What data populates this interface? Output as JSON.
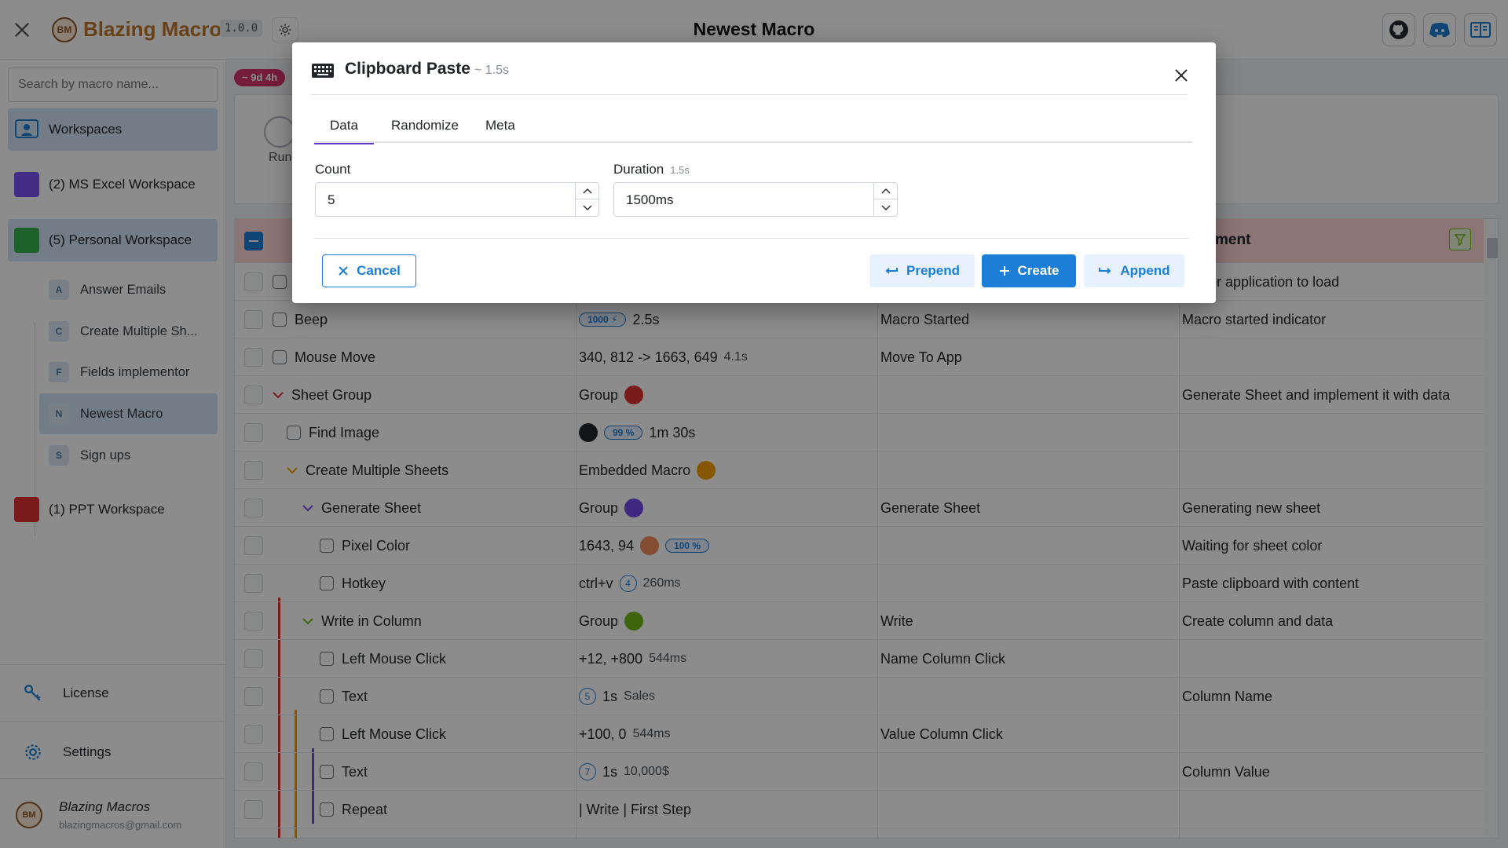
{
  "app": {
    "brand": "Blazing Macros",
    "logo_text": "BM",
    "version": "1.0.0",
    "page_title": "Newest Macro"
  },
  "icons": {
    "close": "close-icon",
    "theme": "sun-icon",
    "github": "github-icon",
    "discord": "discord-icon",
    "docs": "book-icon",
    "keyboard": "keyboard-icon"
  },
  "colors": {
    "accent": "#1c7ed6",
    "brand": "#c0772b",
    "tab_active": "#5f3dc4",
    "badge": "#d6336c"
  },
  "sidebar": {
    "search_placeholder": "Search by macro name...",
    "workspaces_label": "Workspaces",
    "workspaces": [
      {
        "label": "(2) MS Excel Workspace",
        "color": "#7950f2"
      },
      {
        "label": "(5) Personal Workspace",
        "color": "#37b24d"
      },
      {
        "label": "(1) PPT Workspace",
        "color": "#e03131"
      }
    ],
    "macros": [
      {
        "letter": "A",
        "label": "Answer Emails"
      },
      {
        "letter": "C",
        "label": "Create Multiple Sh..."
      },
      {
        "letter": "F",
        "label": "Fields implementor"
      },
      {
        "letter": "N",
        "label": "Newest Macro"
      },
      {
        "letter": "S",
        "label": "Sign ups"
      }
    ],
    "license": "License",
    "settings": "Settings",
    "user_name": "Blazing Macros",
    "user_email": "blazingmacros@gmail.com"
  },
  "main": {
    "time_badge": "~ 9d 4h",
    "run_label": "Run",
    "comment_header": "ment",
    "rows": [
      {
        "name": "",
        "value": "",
        "label": "",
        "comment": "ing for application to load"
      },
      {
        "name": "Beep",
        "pill": "1000 ⚡",
        "value": "2.5s",
        "label": "Macro Started",
        "comment": "Macro started indicator"
      },
      {
        "name": "Mouse Move",
        "value": "340, 812 -> 1663, 649",
        "sub": "4.1s",
        "label": "Move To App",
        "comment": ""
      },
      {
        "name": "Sheet Group",
        "value": "Group",
        "dot": "#e03131",
        "label": "",
        "comment": "Generate Sheet and implement it with data"
      },
      {
        "name": "Find Image",
        "pill": "99 %",
        "value": "1m 30s",
        "label": "",
        "comment": ""
      },
      {
        "name": "Create Multiple Sheets",
        "value": "Embedded Macro",
        "dot": "#f59f00",
        "label": "",
        "comment": ""
      },
      {
        "name": "Generate Sheet",
        "value": "Group",
        "dot": "#7048e8",
        "label": "Generate Sheet",
        "comment": "Generating new sheet"
      },
      {
        "name": "Pixel Color",
        "value": "1643, 94",
        "dot": "#f08c5a",
        "pill": "100 %",
        "label": "",
        "comment": "Waiting for sheet color"
      },
      {
        "name": "Hotkey",
        "value": "ctrl+v",
        "circ": "4",
        "sub": "260ms",
        "label": "",
        "comment": "Paste clipboard with content"
      },
      {
        "name": "Write in Column",
        "value": "Group",
        "dot": "#74b816",
        "label": "Write",
        "comment": "Create column and data"
      },
      {
        "name": "Left Mouse Click",
        "value": "+12, +800",
        "sub": "544ms",
        "label": "Name Column Click",
        "comment": ""
      },
      {
        "name": "Text",
        "circ": "5",
        "value": "1s",
        "sub": "Sales",
        "label": "",
        "comment": "Column Name"
      },
      {
        "name": "Left Mouse Click",
        "value": "+100, 0",
        "sub": "544ms",
        "label": "Value Column Click",
        "comment": ""
      },
      {
        "name": "Text",
        "circ": "7",
        "value": "1s",
        "sub": "10,000$",
        "label": "",
        "comment": "Column Value"
      },
      {
        "name": "Repeat",
        "value": "| Write | First Step",
        "label": "",
        "comment": ""
      }
    ]
  },
  "modal": {
    "title": "Clipboard Paste",
    "duration": "~ 1.5s",
    "tabs": [
      "Data",
      "Randomize",
      "Meta"
    ],
    "count_label": "Count",
    "count_value": "5",
    "duration_label": "Duration",
    "duration_hint": "1.5s",
    "duration_value": "1500ms",
    "cancel": "Cancel",
    "prepend": "Prepend",
    "create": "Create",
    "append": "Append"
  }
}
